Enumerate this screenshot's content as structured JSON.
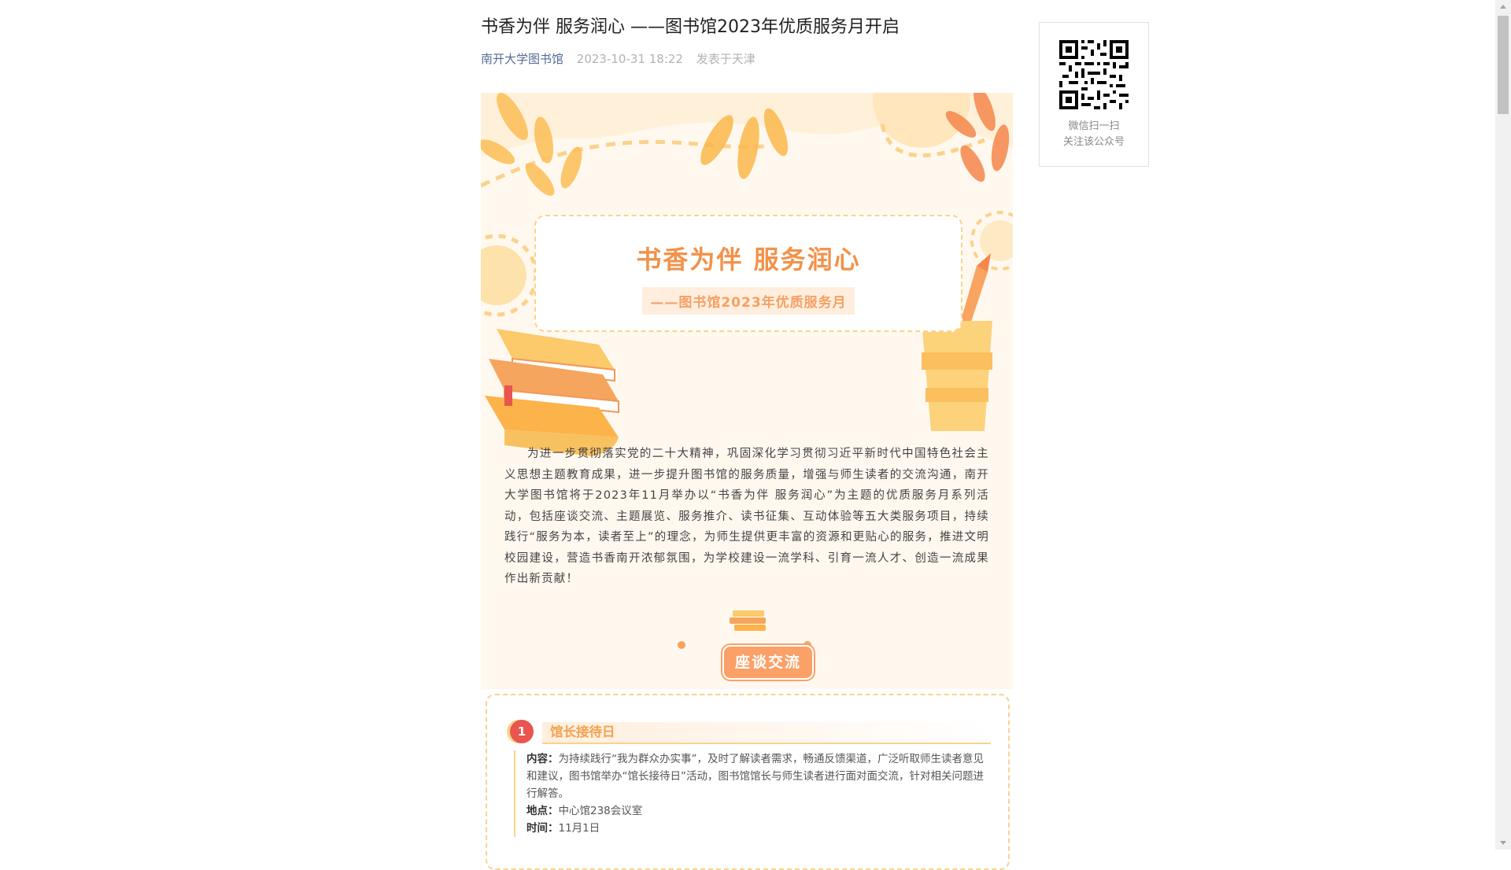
{
  "article": {
    "title": "书香为伴 服务润心 ——图书馆2023年优质服务月开启",
    "author": "南开大学图书馆",
    "date": "2023-10-31 18:22",
    "location": "发表于天津"
  },
  "poster": {
    "title": "书香为伴 服务润心",
    "subtitle": "——图书馆2023年优质服务月",
    "intro": "为进一步贯彻落实党的二十大精神，巩固深化学习贯彻习近平新时代中国特色社会主义思想主题教育成果，进一步提升图书馆的服务质量，增强与师生读者的交流沟通，南开大学图书馆将于2023年11月举办以“书香为伴 服务润心”为主题的优质服务月系列活动，包括座谈交流、主题展览、服务推介、读书征集、互动体验等五大类服务项目，持续践行“服务为本，读者至上”的理念，为师生提供更丰富的资源和更贴心的服务，推进文明校园建设，营造书香南开浓郁氛围，为学校建设一流学科、引育一流人才、创造一流成果作出新贡献！",
    "section_label": "座谈交流"
  },
  "item": {
    "number": "1",
    "title": "馆长接待日",
    "content_label": "内容：",
    "content": "为持续践行“我为群众办实事”，及时了解读者需求，畅通反馈渠道，广泛听取师生读者意见和建议，图书馆举办“馆长接待日”活动，图书馆馆长与师生读者进行面对面交流，针对相关问题进行解答。",
    "place_label": "地点：",
    "place": "中心馆238会议室",
    "time_label": "时间：",
    "time": "11月1日"
  },
  "qr": {
    "line1": "微信扫一扫",
    "line2": "关注该公众号"
  },
  "colors": {
    "accent_orange": "#f2924a",
    "dashed_yellow": "#fbd28c",
    "number_red": "#e9554f",
    "author_link": "#576b95"
  }
}
